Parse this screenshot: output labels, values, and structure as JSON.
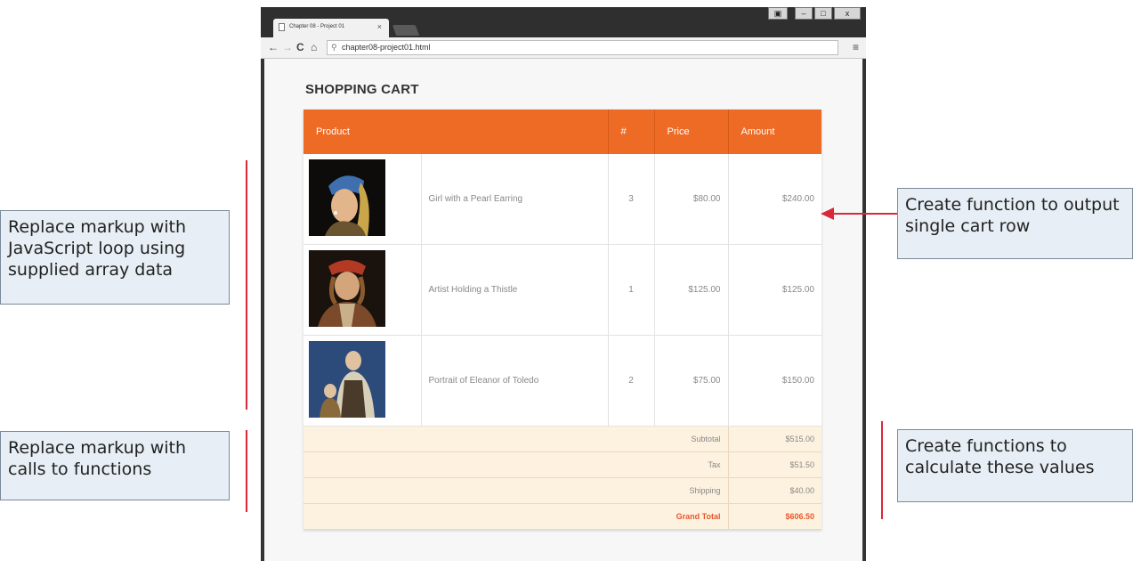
{
  "browser": {
    "tab_title": "Chapter 08 - Project 01",
    "tab_close": "×",
    "url": "chapter08-project01.html",
    "controls": {
      "minimize": "–",
      "maximize": "□",
      "close": "x"
    }
  },
  "page": {
    "title": "SHOPPING CART",
    "columns": [
      "Product",
      "#",
      "Price",
      "Amount"
    ],
    "rows": [
      {
        "name": "Girl with a Pearl Earring",
        "qty": "3",
        "price": "$80.00",
        "amount": "$240.00",
        "image": "painting-pearl-earring"
      },
      {
        "name": "Artist Holding a Thistle",
        "qty": "1",
        "price": "$125.00",
        "amount": "$125.00",
        "image": "painting-thistle"
      },
      {
        "name": "Portrait of Eleanor of Toledo",
        "qty": "2",
        "price": "$75.00",
        "amount": "$150.00",
        "image": "painting-eleanor"
      }
    ],
    "summary": {
      "subtotal_label": "Subtotal",
      "subtotal": "$515.00",
      "tax_label": "Tax",
      "tax": "$51.50",
      "shipping_label": "Shipping",
      "shipping": "$40.00",
      "grand_label": "Grand Total",
      "grand": "$606.50"
    }
  },
  "annotations": {
    "loop": "Replace markup with JavaScript loop using supplied array data",
    "calls": "Replace markup with calls to functions",
    "row_fn": "Create function to output single cart row",
    "calc_fn": "Create functions to calculate these values"
  },
  "colors": {
    "header": "#ee6b26",
    "summary_bg": "#fdf2df",
    "grand_total": "#e8572b",
    "annotation_line": "#d9283a"
  }
}
